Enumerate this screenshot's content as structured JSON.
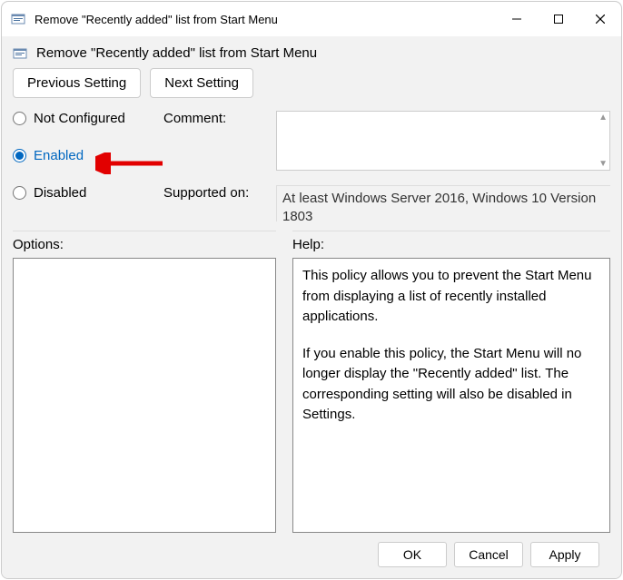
{
  "window": {
    "title": "Remove \"Recently added\" list from Start Menu"
  },
  "header": {
    "title": "Remove \"Recently added\" list from Start Menu"
  },
  "nav": {
    "prev": "Previous Setting",
    "next": "Next Setting"
  },
  "policy": {
    "not_configured": "Not Configured",
    "enabled": "Enabled",
    "disabled": "Disabled",
    "selected": "enabled",
    "comment_label": "Comment:",
    "supported_label": "Supported on:",
    "supported_text": "At least Windows Server 2016, Windows 10 Version 1803"
  },
  "lower": {
    "options_label": "Options:",
    "help_label": "Help:",
    "help_p1": "This policy allows you to prevent the Start Menu from displaying a list of recently installed applications.",
    "help_p2": "If you enable this policy, the Start Menu will no longer display the \"Recently added\" list. The corresponding setting will also be disabled in Settings."
  },
  "footer": {
    "ok": "OK",
    "cancel": "Cancel",
    "apply": "Apply"
  }
}
